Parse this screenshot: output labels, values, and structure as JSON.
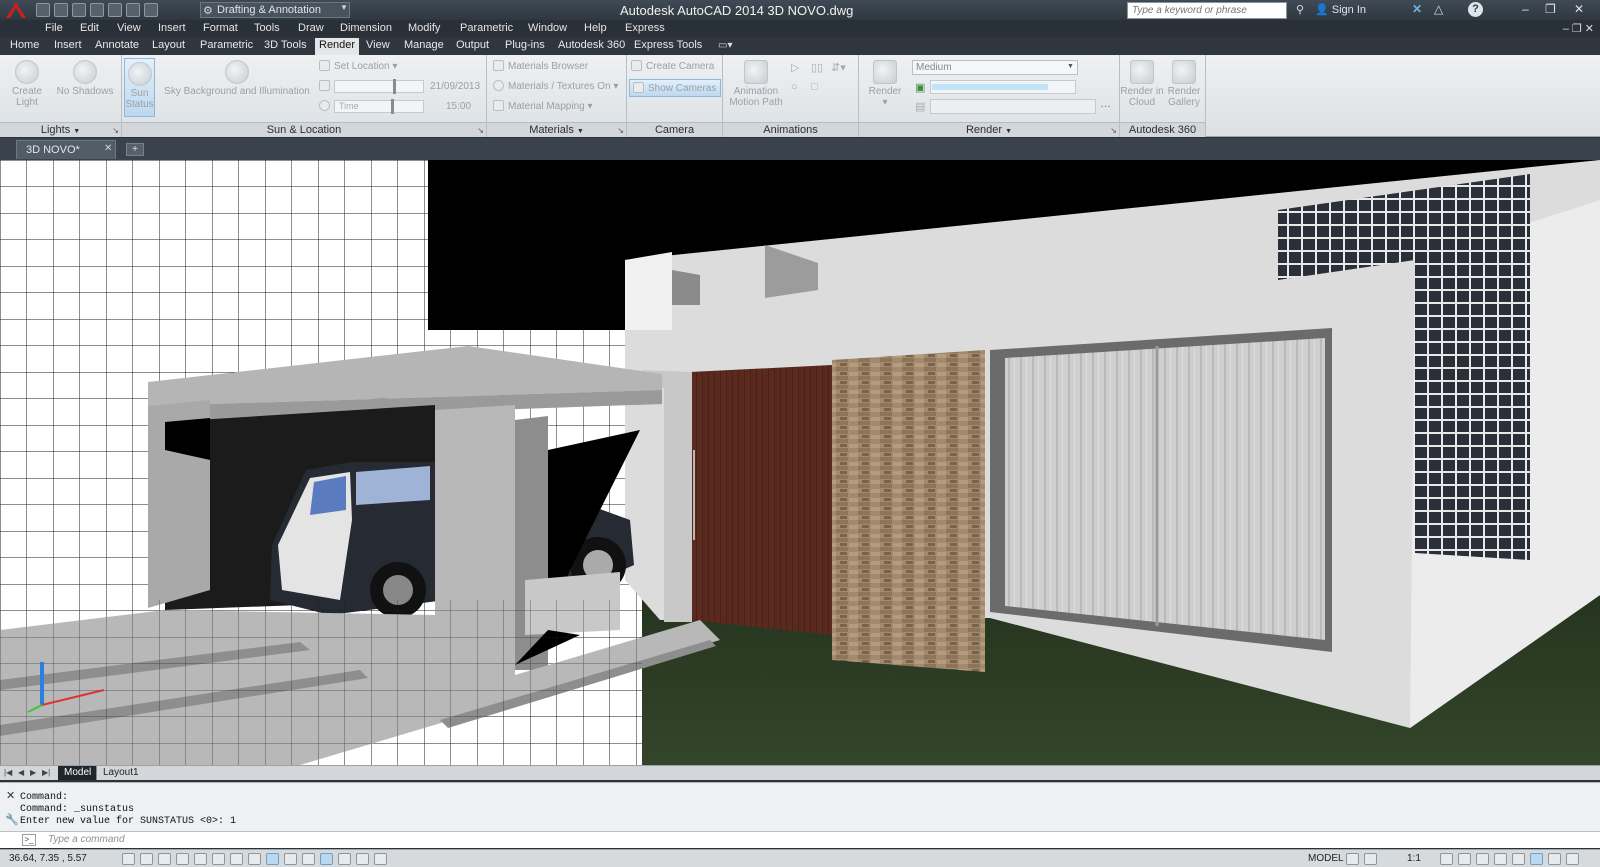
{
  "title_bar": {
    "app_title": "Autodesk AutoCAD 2014    3D NOVO.dwg",
    "workspace": "Drafting & Annotation",
    "search_placeholder": "Type a keyword or phrase",
    "sign_in": "Sign In",
    "help": "?"
  },
  "menu": {
    "items": [
      "File",
      "Edit",
      "View",
      "Insert",
      "Format",
      "Tools",
      "Draw",
      "Dimension",
      "Modify",
      "Parametric",
      "Window",
      "Help",
      "Express"
    ]
  },
  "ribbon_tabs": {
    "items": [
      "Home",
      "Insert",
      "Annotate",
      "Layout",
      "Parametric",
      "3D Tools",
      "Render",
      "View",
      "Manage",
      "Output",
      "Plug-ins",
      "Autodesk 360",
      "Express Tools"
    ],
    "active": "Render"
  },
  "ribbon": {
    "lights": {
      "title": "Lights",
      "create_light_1": "Create",
      "create_light_2": "Light",
      "no_shadows": "No Shadows",
      "sun_status_1": "Sun",
      "sun_status_2": "Status"
    },
    "sun_location": {
      "title": "Sun & Location",
      "sky": "Sky Background and Illumination",
      "set_location": "Set Location",
      "date": "21/09/2013",
      "time_label": "Time",
      "time": "15:00"
    },
    "materials": {
      "title": "Materials",
      "browser": "Materials Browser",
      "textures": "Materials / Textures On",
      "mapping": "Material Mapping"
    },
    "camera": {
      "title": "Camera",
      "create": "Create Camera",
      "show": "Show  Cameras"
    },
    "animations": {
      "title": "Animations",
      "motion_path_1": "Animation",
      "motion_path_2": "Motion Path"
    },
    "render": {
      "title": "Render",
      "render_btn": "Render",
      "preset": "Medium",
      "progress": 0.82
    },
    "autodesk360": {
      "title": "Autodesk 360",
      "cloud_1": "Render in",
      "cloud_2": "Cloud",
      "gallery_1": "Render",
      "gallery_2": "Gallery"
    }
  },
  "doc_tabs": {
    "active": "3D NOVO*"
  },
  "layout_tabs": {
    "model": "Model",
    "layout1": "Layout1"
  },
  "command": {
    "history": [
      "Command:",
      "Command: _sunstatus",
      "Enter new value for SUNSTATUS <0>: 1"
    ],
    "placeholder": "Type a command"
  },
  "status_bar": {
    "coords": "36.64,  7.35  , 5.57",
    "model": "MODEL",
    "scale": "1:1"
  },
  "colors": {
    "accent": "#bcd8ef",
    "titlebar": "#3f4a55",
    "ribbon": "#e4e6e8",
    "viewport_sky": "#000000",
    "grass": "#2b3a22",
    "wall": "#dcdcdc",
    "door": "#5b2a1e"
  }
}
